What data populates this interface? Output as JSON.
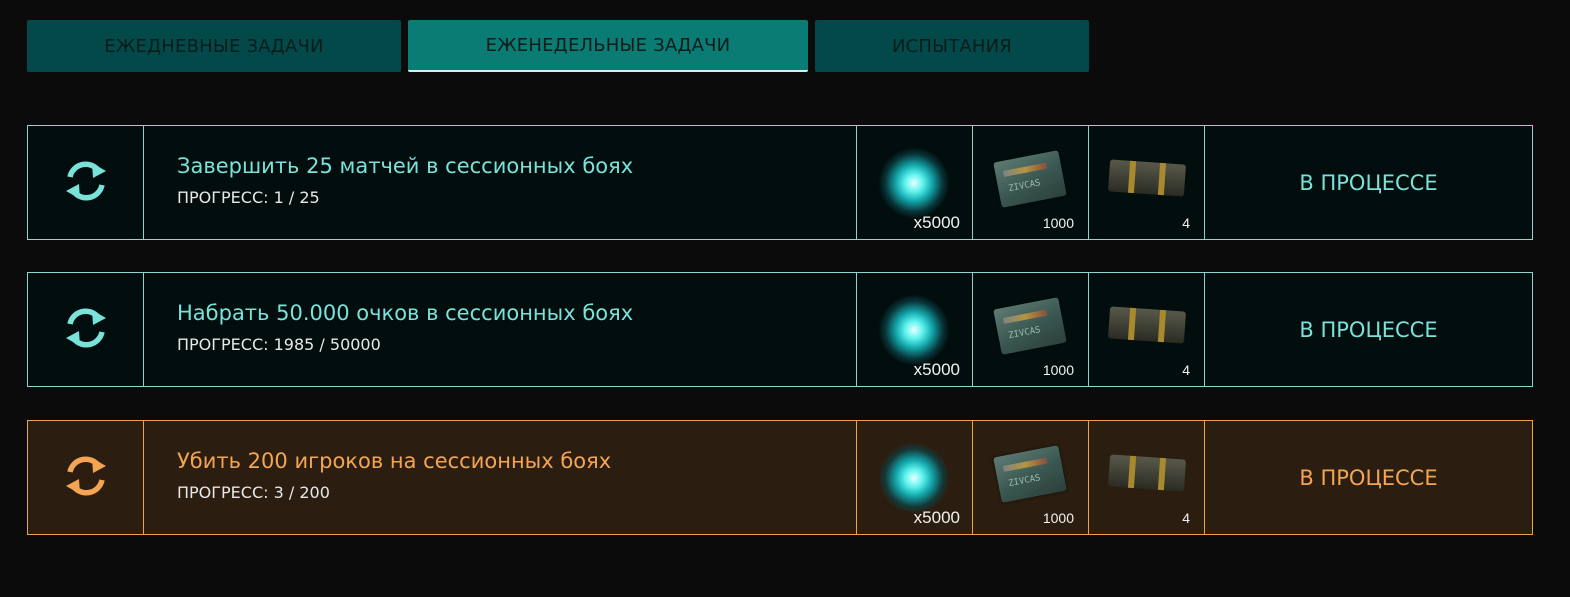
{
  "tabs": [
    {
      "label": "ЕЖЕДНЕВНЫЕ ЗАДАЧИ",
      "active": false
    },
    {
      "label": "ЕЖЕНЕДЕЛЬНЫЕ ЗАДАЧИ",
      "active": true
    },
    {
      "label": "ИСПЫТАНИЯ",
      "active": false
    }
  ],
  "colors": {
    "accent_teal": "#79e3da",
    "accent_orange": "#f3a553"
  },
  "tasks": [
    {
      "icon": "refresh-icon",
      "title": "Завершить 25 матчей в сессионных боях",
      "progress": "ПРОГРЕСС: 1 / 25",
      "rewards": [
        {
          "icon": "energy-orb-icon",
          "qty": "x5000"
        },
        {
          "icon": "ticket-icon",
          "qty": "1000"
        },
        {
          "icon": "crate-icon",
          "qty": "4"
        }
      ],
      "status": "В ПРОЦЕССЕ",
      "highlight": false
    },
    {
      "icon": "refresh-icon",
      "title": "Набрать 50.000 очков в сессионных боях",
      "progress": "ПРОГРЕСС: 1985 / 50000",
      "rewards": [
        {
          "icon": "energy-orb-icon",
          "qty": "x5000"
        },
        {
          "icon": "ticket-icon",
          "qty": "1000"
        },
        {
          "icon": "crate-icon",
          "qty": "4"
        }
      ],
      "status": "В ПРОЦЕССЕ",
      "highlight": false
    },
    {
      "icon": "refresh-icon",
      "title": "Убить 200 игроков на сессионных боях",
      "progress": "ПРОГРЕСС: 3 / 200",
      "rewards": [
        {
          "icon": "energy-orb-icon",
          "qty": "x5000"
        },
        {
          "icon": "ticket-icon",
          "qty": "1000"
        },
        {
          "icon": "crate-icon",
          "qty": "4"
        }
      ],
      "status": "В ПРОЦЕССЕ",
      "highlight": true
    }
  ]
}
